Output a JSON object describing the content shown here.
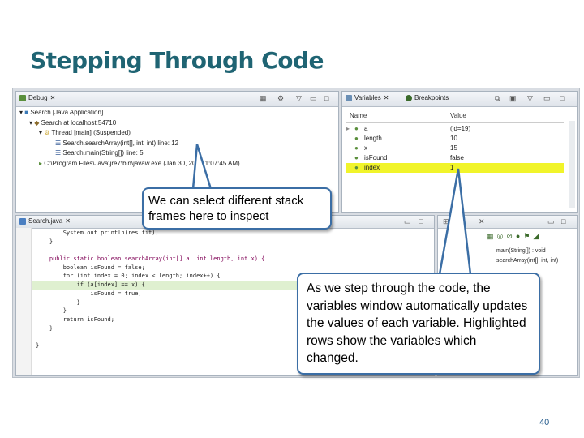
{
  "slide": {
    "title": "Stepping Through Code",
    "page_number": "40"
  },
  "debug_view": {
    "tab_label": "Debug",
    "tree": [
      "Search [Java Application]",
      "Search at localhost:54710",
      "Thread [main] (Suspended)",
      "Search.searchArray(int[], int, int) line: 12",
      "Search.main(String[]) line: 5",
      "C:\\Program Files\\Java\\jre7\\bin\\javaw.exe (Jan 30, 2012 1:07:45 AM)"
    ]
  },
  "variables_view": {
    "tab_label": "Variables",
    "other_tab_label": "Breakpoints",
    "columns": [
      "Name",
      "Value"
    ],
    "rows": [
      {
        "name": "a",
        "value": "(id=19)",
        "highlighted": false
      },
      {
        "name": "length",
        "value": "10",
        "highlighted": false
      },
      {
        "name": "x",
        "value": "15",
        "highlighted": false
      },
      {
        "name": "isFound",
        "value": "false",
        "highlighted": false
      },
      {
        "name": "index",
        "value": "1",
        "highlighted": true
      }
    ],
    "highlight_color": "#f1f42a"
  },
  "editor": {
    "tab_label": "Search.java",
    "lines": [
      "        System.out.println(res.fit);",
      "    }",
      "",
      "    public static boolean searchArray(int[] a, int length, int x) {",
      "        boolean isFound = false;",
      "        for (int index = 0; index < length; index++) {",
      "            if (a[index] == x) {",
      "                isFound = true;",
      "            }",
      "        }",
      "        return isFound;",
      "    }",
      "",
      "}"
    ],
    "current_line_color": "#dff0d0"
  },
  "outline_view": {
    "lines": [
      "main(String[]) : void",
      "searchArray(int[], int, int)"
    ]
  },
  "callouts": {
    "stack": "We can select different stack frames here to inspect",
    "variables": "As we step through the code, the variables window automatically updates the values of each variable. Highlighted rows show the variables which changed."
  },
  "icons": [
    "debug-icon",
    "variables-icon",
    "breakpoints-icon",
    "java-file-icon",
    "thread-icon",
    "stack-frame-icon",
    "minimize-icon",
    "maximize-icon",
    "close-icon"
  ]
}
